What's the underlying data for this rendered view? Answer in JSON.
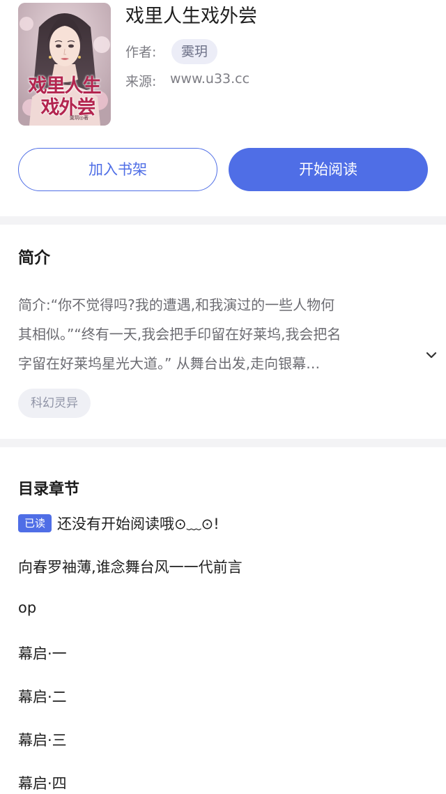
{
  "book": {
    "title": "戏里人生戏外尝",
    "author_label": "作者:",
    "author": "霙玥",
    "source_label": "来源:",
    "source": "www.u33.cc",
    "cover": {
      "title_line1": "戏里人生",
      "title_line2": "戏外尝",
      "author_mark": "霙玥◎著"
    }
  },
  "actions": {
    "add_shelf": "加入书架",
    "start_read": "开始阅读"
  },
  "intro": {
    "heading": "简介",
    "lines": [
      "简介:“你不觉得吗?我的遭遇,和我演过的一些人物何",
      "其相似。”“终有一天,我会把手印留在好莱坞,我会把名",
      "字留在好莱坞星光大道。”        从舞台出发,走向银幕…"
    ],
    "tag": "科幻灵异",
    "expand_icon": "chevron-down-icon"
  },
  "catalog": {
    "heading": "目录章节",
    "read_badge": "已读",
    "status": "还没有开始阅读哦⊙﹏⊙!",
    "chapters": [
      "向春罗袖薄,谁念舞台风一一代前言",
      "op",
      "幕启·一",
      "幕启·二",
      "幕启·三",
      "幕启·四"
    ]
  },
  "colors": {
    "accent": "#4f6ee6",
    "chip_bg": "#ecedf7",
    "divider": "#f3f3f5"
  }
}
